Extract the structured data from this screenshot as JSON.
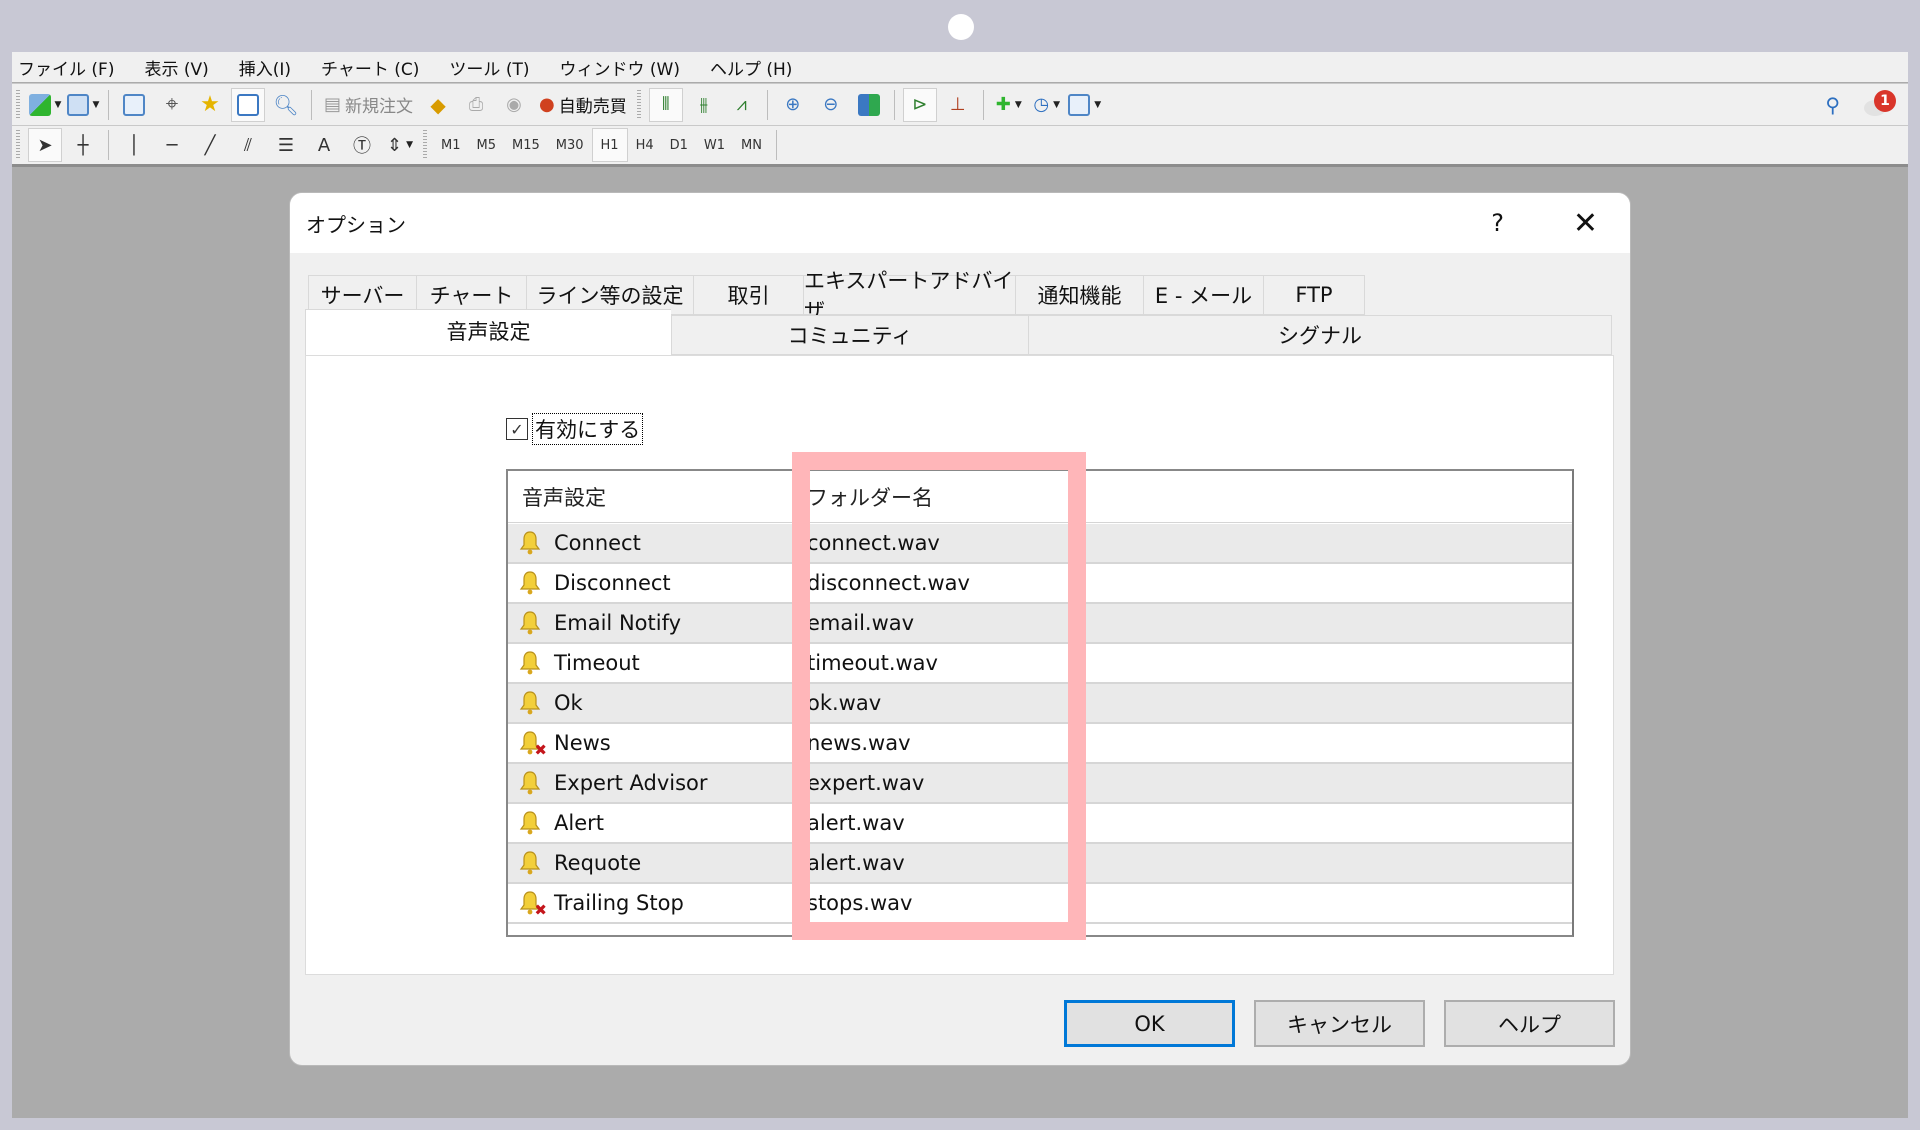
{
  "app": {
    "menu": [
      "ファイル (F)",
      "表示 (V)",
      "挿入(I)",
      "チャート (C)",
      "ツール (T)",
      "ウィンドウ (W)",
      "ヘルプ (H)"
    ],
    "toolbar1": {
      "new_order_label": "新規注文",
      "auto_trading_label": "自動売買",
      "notification_count": "1"
    },
    "timeframes": [
      "M1",
      "M5",
      "M15",
      "M30",
      "H1",
      "H4",
      "D1",
      "W1",
      "MN"
    ],
    "active_timeframe": "H1"
  },
  "dialog": {
    "title": "オプション",
    "help_glyph": "?",
    "close_glyph": "✕",
    "tabs_row1": [
      "サーバー",
      "チャート",
      "ライン等の設定",
      "取引",
      "エキスパートアドバイザ",
      "通知機能",
      "E - メール",
      "FTP"
    ],
    "tabs_row2": [
      "音声設定",
      "コミュニティ",
      "シグナル"
    ],
    "active_tab": "音声設定",
    "enable_checkbox": {
      "label": "有効にする",
      "checked": true
    },
    "list": {
      "headers": [
        "音声設定",
        "フォルダー名",
        ""
      ],
      "rows": [
        {
          "event": "Connect",
          "file": "connect.wav",
          "enabled": true
        },
        {
          "event": "Disconnect",
          "file": "disconnect.wav",
          "enabled": true
        },
        {
          "event": "Email Notify",
          "file": "email.wav",
          "enabled": true
        },
        {
          "event": "Timeout",
          "file": "timeout.wav",
          "enabled": true
        },
        {
          "event": "Ok",
          "file": "ok.wav",
          "enabled": true
        },
        {
          "event": "News",
          "file": "news.wav",
          "enabled": false
        },
        {
          "event": "Expert Advisor",
          "file": "expert.wav",
          "enabled": true
        },
        {
          "event": "Alert",
          "file": "alert.wav",
          "enabled": true
        },
        {
          "event": "Requote",
          "file": "alert.wav",
          "enabled": true
        },
        {
          "event": "Trailing Stop",
          "file": "stops.wav",
          "enabled": false
        }
      ]
    },
    "buttons": {
      "ok": "OK",
      "cancel": "キャンセル",
      "help": "ヘルプ"
    },
    "highlight_color": "#ffb6b9"
  }
}
